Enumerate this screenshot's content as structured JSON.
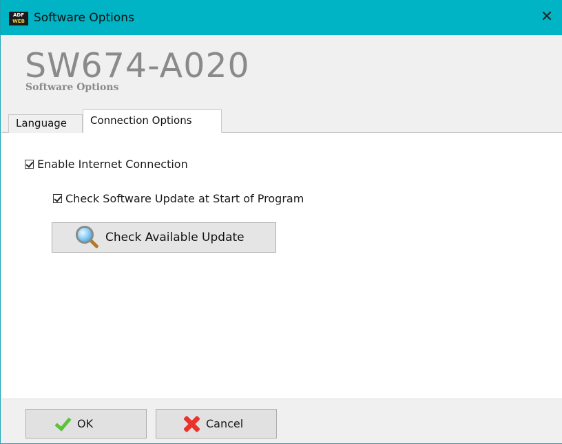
{
  "window": {
    "title": "Software Options",
    "app_icon_line1": "ADF",
    "app_icon_line2": "WEB",
    "close_glyph": "✕"
  },
  "header": {
    "product_code": "SW674-A020",
    "subtitle": "Software Options"
  },
  "tabs": [
    {
      "label": "Language",
      "active": false
    },
    {
      "label": "Connection Options",
      "active": true
    }
  ],
  "connection_options": {
    "enable_internet": {
      "label": "Enable Internet Connection",
      "checked": true
    },
    "check_update_at_start": {
      "label": "Check Software Update at Start of Program",
      "checked": true
    },
    "check_update_button": {
      "label": "Check Available Update",
      "icon": "magnifier-icon"
    }
  },
  "footer": {
    "ok_label": "OK",
    "ok_icon": "checkmark-icon",
    "cancel_label": "Cancel",
    "cancel_icon": "red-x-icon"
  },
  "colors": {
    "titlebar": "#00b4c5",
    "ok_check": "#5cc23a",
    "cancel_x": "#e8342b"
  }
}
